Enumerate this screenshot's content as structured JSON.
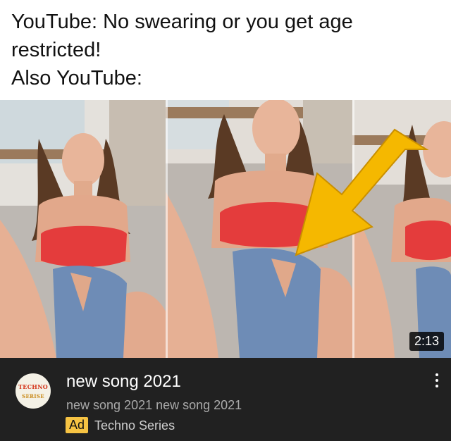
{
  "caption": {
    "lines": [
      "YouTube: No swearing or you get age",
      "restricted!",
      "Also YouTube:"
    ]
  },
  "thumbnail": {
    "duration": "2:13",
    "arrow_color": "#f5b800"
  },
  "video": {
    "title": "new song 2021",
    "description": "new song 2021 new song 2021",
    "ad_label": "Ad",
    "channel": "Techno Series",
    "avatar_logo_lines": [
      "TECHNO",
      "SERISE"
    ],
    "more_icon": "vertical-dots-icon"
  },
  "colors": {
    "info_background": "#212121",
    "ad_badge": "#f6c343"
  }
}
